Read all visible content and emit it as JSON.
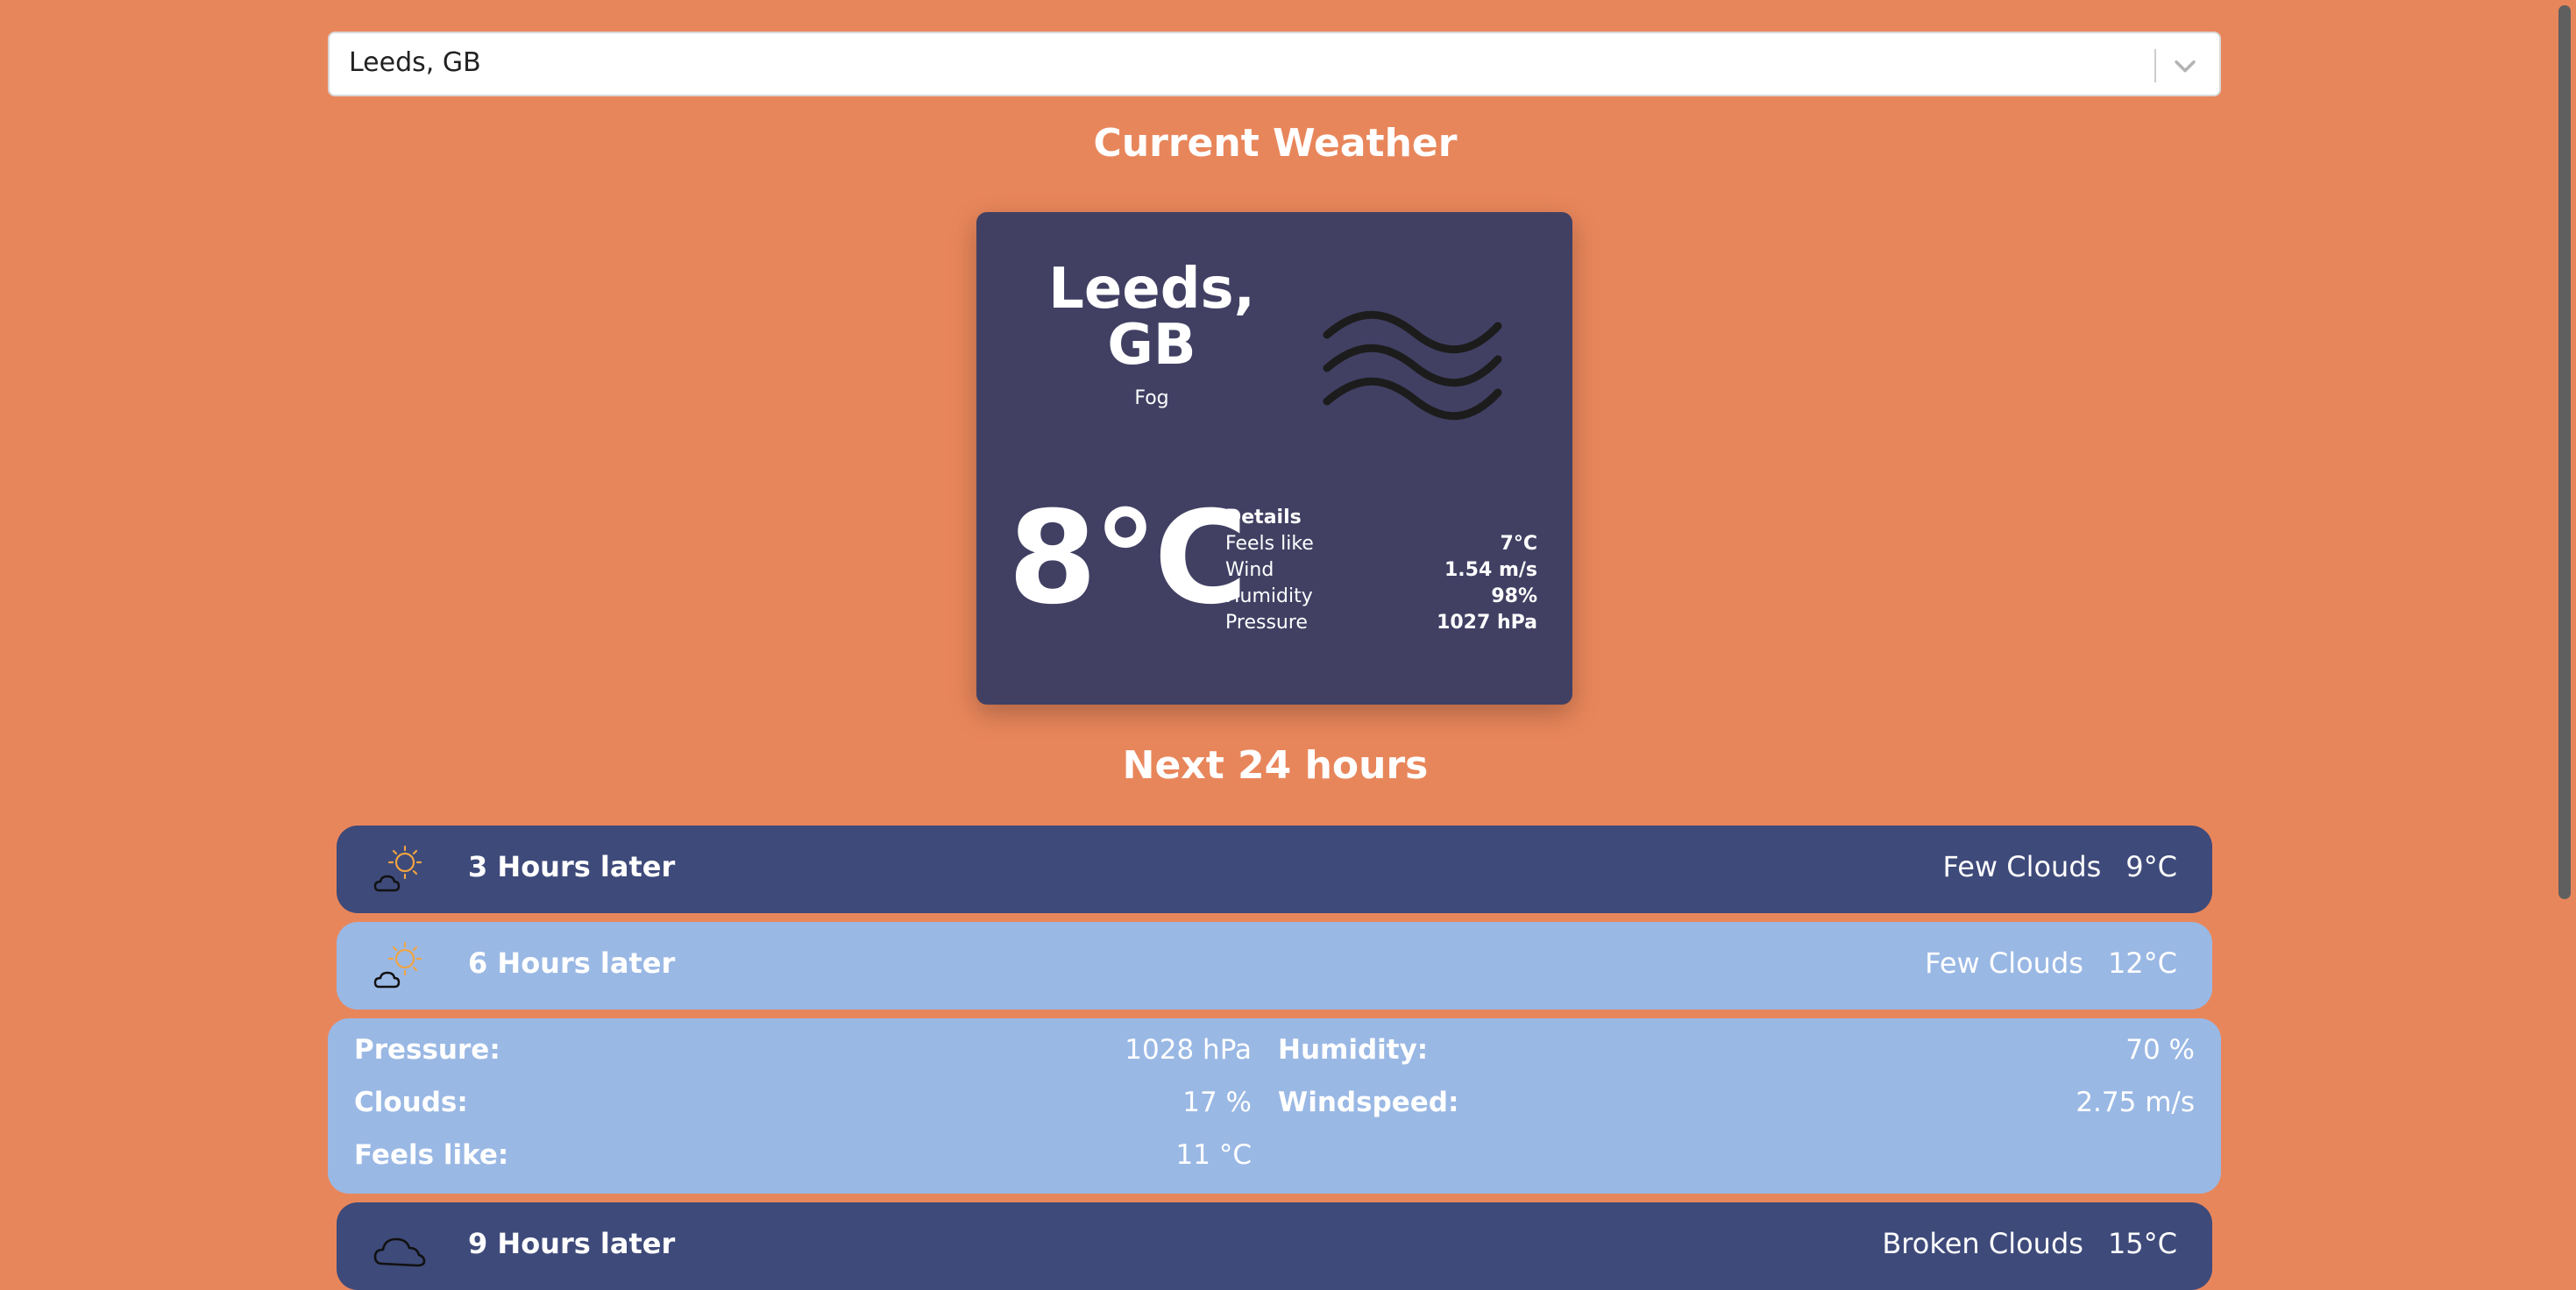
{
  "search": {
    "value": "Leeds, GB"
  },
  "headings": {
    "current": "Current Weather",
    "next": "Next 24 hours"
  },
  "current": {
    "city_line1": "Leeds,",
    "city_line2": "GB",
    "description": "Fog",
    "temperature": "8°C",
    "icon": "fog-icon",
    "details_title": "Details",
    "details": [
      {
        "label": "Feels like",
        "value": "7°C"
      },
      {
        "label": "Wind",
        "value": "1.54 m/s"
      },
      {
        "label": "Humidity",
        "value": "98%"
      },
      {
        "label": "Pressure",
        "value": "1027 hPa"
      }
    ]
  },
  "forecast": [
    {
      "label": "3 Hours later",
      "description": "Few Clouds",
      "temp": "9°C",
      "icon": "few-clouds-icon"
    },
    {
      "label": "6 Hours later",
      "description": "Few Clouds",
      "temp": "12°C",
      "icon": "few-clouds-icon"
    },
    {
      "label": "9 Hours later",
      "description": "Broken Clouds",
      "temp": "15°C",
      "icon": "broken-clouds-icon"
    }
  ],
  "expanded": {
    "pressure_label": "Pressure:",
    "pressure_value": "1028 hPa",
    "humidity_label": "Humidity:",
    "humidity_value": "70 %",
    "clouds_label": "Clouds:",
    "clouds_value": "17 %",
    "windspeed_label": "Windspeed:",
    "windspeed_value": "2.75 m/s",
    "feels_label": "Feels like:",
    "feels_value": "11 °C"
  },
  "colors": {
    "background": "#e8865b",
    "card": "#414063",
    "row_dark": "#3e4a7a",
    "row_light": "#9ab8e4"
  }
}
